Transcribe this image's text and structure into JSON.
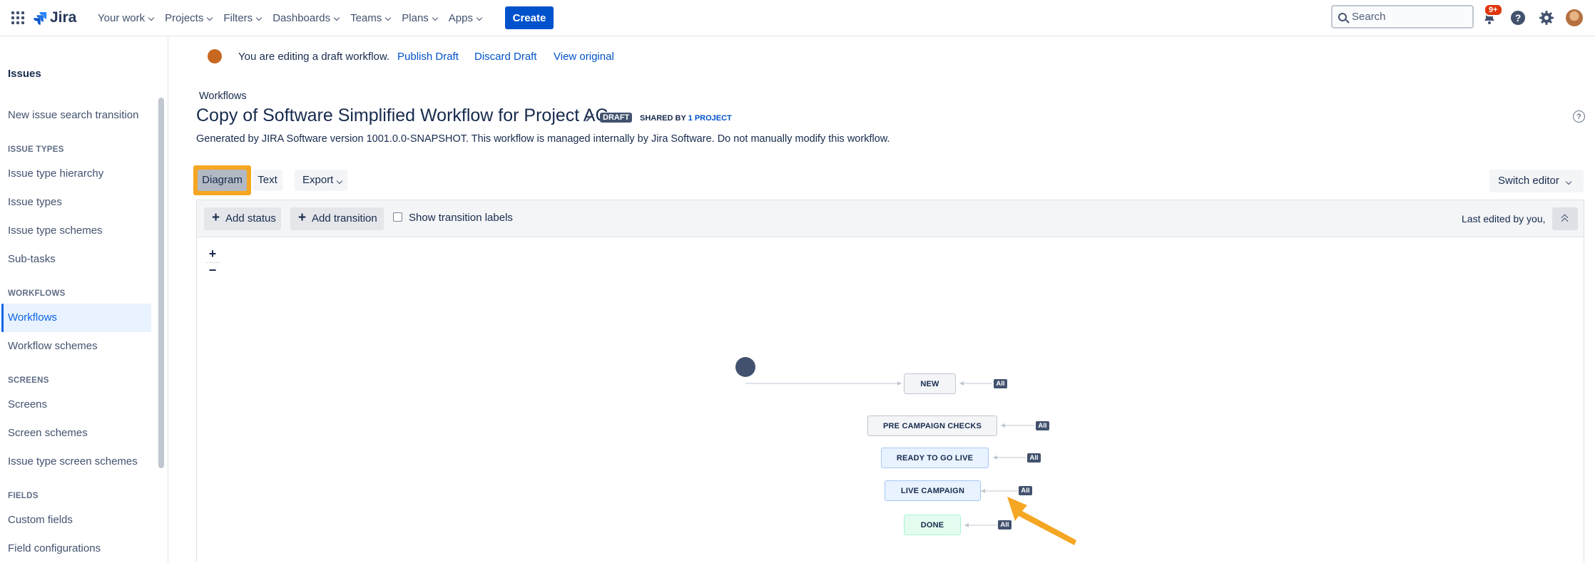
{
  "header": {
    "logo_text": "Jira",
    "nav": [
      "Your work",
      "Projects",
      "Filters",
      "Dashboards",
      "Teams",
      "Plans",
      "Apps"
    ],
    "create_label": "Create",
    "search_placeholder": "Search",
    "notifications_count": "9+"
  },
  "sidebar": {
    "title": "Issues",
    "items": {
      "new_issue_search": "New issue search transition",
      "issue_types_head": "ISSUE TYPES",
      "issue_type_hierarchy": "Issue type hierarchy",
      "issue_types": "Issue types",
      "issue_type_schemes": "Issue type schemes",
      "sub_tasks": "Sub-tasks",
      "workflows_head": "WORKFLOWS",
      "workflows": "Workflows",
      "workflow_schemes": "Workflow schemes",
      "screens_head": "SCREENS",
      "screens": "Screens",
      "screen_schemes": "Screen schemes",
      "issue_type_screen_schemes": "Issue type screen schemes",
      "fields_head": "FIELDS",
      "custom_fields": "Custom fields",
      "field_configurations": "Field configurations"
    }
  },
  "draft_bar": {
    "message": "You are editing a draft workflow.",
    "publish": "Publish Draft",
    "discard": "Discard Draft",
    "view_original": "View original"
  },
  "page": {
    "breadcrumb": "Workflows",
    "title": "Copy of Software Simplified Workflow for Project AC",
    "draft_badge": "DRAFT",
    "shared_by": "SHARED BY",
    "shared_projects": "1 PROJECT",
    "description": "Generated by JIRA Software version 1001.0.0-SNAPSHOT. This workflow is managed internally by Jira Software. Do not manually modify this workflow."
  },
  "tabs": {
    "diagram": "Diagram",
    "text": "Text",
    "export": "Export",
    "switch_editor": "Switch editor"
  },
  "toolbar": {
    "add_status": "Add status",
    "add_transition": "Add transition",
    "show_labels": "Show transition labels",
    "last_edited": "Last edited by you,"
  },
  "zoom": {
    "in": "+",
    "out": "−"
  },
  "statuses": {
    "new": "NEW",
    "pre_campaign": "PRE CAMPAIGN CHECKS",
    "ready": "READY TO GO LIVE",
    "live": "LIVE CAMPAIGN",
    "done": "DONE"
  },
  "all_label": "All",
  "colors": {
    "brand": "#0052cc",
    "highlight": "#f5a623",
    "status_done": "#e3fcef",
    "status_in_progress": "#e9f2ff",
    "status_todo": "#f4f5f7"
  }
}
